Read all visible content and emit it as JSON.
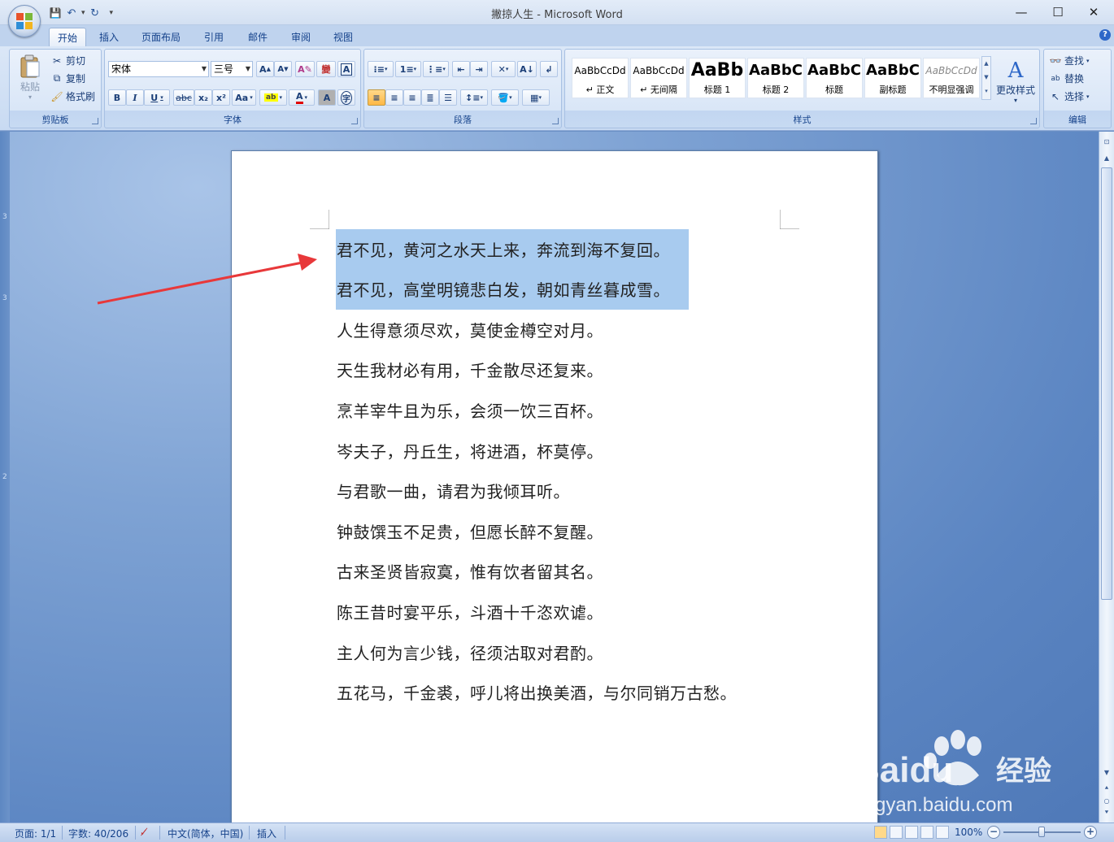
{
  "window": {
    "title": "撇掠人生 - Microsoft Word",
    "controls": {
      "minimize": "—",
      "maximize": "☐",
      "close": "✕"
    }
  },
  "qat": {
    "save": "💾",
    "undo": "↶",
    "redo": "↻",
    "more": "▾"
  },
  "tabs": [
    {
      "label": "开始",
      "active": true
    },
    {
      "label": "插入"
    },
    {
      "label": "页面布局"
    },
    {
      "label": "引用"
    },
    {
      "label": "邮件"
    },
    {
      "label": "审阅"
    },
    {
      "label": "视图"
    }
  ],
  "ribbon": {
    "clipboard": {
      "label": "剪贴板",
      "paste": "粘贴",
      "cut": "剪切",
      "copy": "复制",
      "format_painter": "格式刷"
    },
    "font": {
      "label": "字体",
      "font_name": "宋体",
      "font_size": "三号",
      "bold": "B",
      "italic": "I",
      "underline": "U",
      "strike": "abc",
      "subscript": "x₂",
      "superscript": "x²",
      "change_case": "Aa",
      "grow": "A",
      "shrink": "A",
      "clear": "A",
      "phonetic": "變",
      "border_char": "A",
      "enclose": "字"
    },
    "paragraph": {
      "label": "段落"
    },
    "styles": {
      "label": "样式",
      "items": [
        {
          "sample": "AaBbCcDd",
          "name": "↵ 正文"
        },
        {
          "sample": "AaBbCcDd",
          "name": "↵ 无间隔"
        },
        {
          "sample": "AaBb",
          "name": "标题 1"
        },
        {
          "sample": "AaBbC",
          "name": "标题 2"
        },
        {
          "sample": "AaBbC",
          "name": "标题"
        },
        {
          "sample": "AaBbC",
          "name": "副标题"
        },
        {
          "sample": "AaBbCcDd",
          "name": "不明显强调"
        }
      ],
      "change_styles": "更改样式"
    },
    "editing": {
      "label": "编辑",
      "find": "查找",
      "replace": "替换",
      "select": "选择"
    }
  },
  "ruler": {
    "marks": [
      "3",
      "3",
      "2"
    ]
  },
  "document": {
    "lines": [
      "君不见，黄河之水天上来，奔流到海不复回。",
      "君不见，高堂明镜悲白发，朝如青丝暮成雪。",
      "人生得意须尽欢，莫使金樽空对月。",
      "天生我材必有用，千金散尽还复来。",
      "烹羊宰牛且为乐，会须一饮三百杯。",
      "岑夫子，丹丘生，将进酒，杯莫停。",
      "与君歌一曲，请君为我倾耳听。",
      "钟鼓馔玉不足贵，但愿长醉不复醒。",
      "古来圣贤皆寂寞，惟有饮者留其名。",
      "陈王昔时宴平乐，斗酒十千恣欢谑。",
      "主人何为言少钱，径须沽取对君酌。",
      "五花马，千金裘，呼儿将出换美酒，与尔同销万古愁。"
    ]
  },
  "status": {
    "page": "页面: 1/1",
    "words": "字数: 40/206",
    "language": "中文(简体，中国)",
    "mode": "插入",
    "zoom": "100%"
  },
  "watermark": {
    "brand": "Baidu",
    "cn": "经验",
    "url": "jingyan.baidu.com"
  },
  "colors": {
    "accent": "#15428b",
    "selection": "#a8cbef",
    "arrow": "#e8383a"
  }
}
